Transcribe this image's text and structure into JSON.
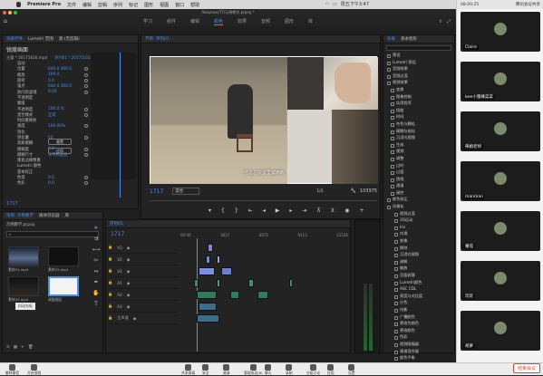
{
  "menubar": {
    "app": "Premiere Pro",
    "items": [
      "文件",
      "编辑",
      "剪辑",
      "序列",
      "标记",
      "图形",
      "视图",
      "窗口",
      "帮助"
    ],
    "clock_left": "周五下午3:47",
    "clock_right": "08:00:25",
    "meeting_label": "腾讯会议共享"
  },
  "window": {
    "title": "/Volumes/T7/示例教学.prproj *"
  },
  "workspaces": {
    "items": [
      "学习",
      "组件",
      "编辑",
      "颜色",
      "效果",
      "音频",
      "图形",
      "库"
    ],
    "active_index": 3
  },
  "effect_controls": {
    "tabs": [
      "效果控件",
      "Lumetri 范围",
      "源:(无剪辑)",
      "音频剪辑混合器:序列01"
    ],
    "title": "锐度画面",
    "source_label": "主要 * 20171616.mp4",
    "clip_label": "序列01 * 20171616.mp4",
    "rows": [
      {
        "k": "运动",
        "v": ""
      },
      {
        "k": "位置",
        "v": "640.0 360.0"
      },
      {
        "k": "缩放",
        "v": "100.0"
      },
      {
        "k": "旋转",
        "v": "0.0"
      },
      {
        "k": "锚点",
        "v": "640.0 360.0"
      },
      {
        "k": "防闪烁滤镜",
        "v": "0.00"
      },
      {
        "k": "不透明度",
        "v": ""
      },
      {
        "k": "蒙版",
        "v": ""
      },
      {
        "k": "不透明度",
        "v": "100.0 %"
      },
      {
        "k": "混合模式",
        "v": "正常"
      },
      {
        "k": "时间重映射",
        "v": ""
      },
      {
        "k": "速度",
        "v": "100.00%"
      },
      {
        "k": "锐化",
        "v": ""
      },
      {
        "k": "锐化量",
        "v": "50"
      },
      {
        "k": "高斯模糊",
        "v": ""
      },
      {
        "k": "模糊度",
        "v": "0.0"
      },
      {
        "k": "模糊尺寸",
        "v": "水平和垂直"
      },
      {
        "k": "重复边缘像素",
        "v": ""
      },
      {
        "k": "Lumetri 颜色",
        "v": ""
      },
      {
        "k": "基本校正",
        "v": ""
      },
      {
        "k": "色温",
        "v": "0.0"
      },
      {
        "k": "色彩",
        "v": "0.0"
      }
    ],
    "btn_reset": "重置",
    "btn_apply": "应用",
    "timecode": "1717"
  },
  "program": {
    "header": "节目: 序列01",
    "subtitle": "他总在院子里做雨靴",
    "timecode": "1717",
    "fit": "适合",
    "quality": "1/2",
    "duration": "103975"
  },
  "project": {
    "tabs": [
      "项目: 示例教学",
      "媒体浏览器",
      "库",
      "信息"
    ],
    "file": "示例教学.prproj",
    "items": [
      {
        "label": "素材01.mp4",
        "time": "3:13"
      },
      {
        "label": "素材02.mp4",
        "time": "5:01"
      },
      {
        "label": "素材03.mp4",
        "time": "2:50"
      },
      {
        "label": "调整图层",
        "time": ""
      }
    ],
    "tooltip": "抖动光标"
  },
  "timeline": {
    "header": "序列01",
    "timecode": "1717",
    "ruler": [
      "00:00",
      "3637",
      "6072",
      "9113",
      "12126"
    ],
    "tracks": [
      "V3",
      "V2",
      "V1",
      "A1",
      "A2",
      "A3",
      "主声道"
    ]
  },
  "right_panel": {
    "tabs": [
      "效果",
      "基本图形"
    ],
    "tree": [
      "预设",
      "Lumetri 预设",
      "音频效果",
      "音频过渡",
      "视频效果",
      "变换",
      "图像控制",
      "实用程序",
      "扭曲",
      "时间",
      "杂色与颗粒",
      "模糊与锐化",
      "沉浸式视频",
      "生成",
      "视频",
      "调整",
      "过时",
      "过渡",
      "透视",
      "通道",
      "键控",
      "颜色校正",
      "风格化",
      "视频过渡",
      "3D运动",
      "Iris",
      "内滑",
      "划像",
      "擦除",
      "沉浸式视频",
      "溶解",
      "缩放",
      "页面剥落",
      "Lumetri颜色",
      "ASC CDL",
      "亮度与对比度",
      "分色",
      "均衡",
      "广播颜色",
      "更改为颜色",
      "更改颜色",
      "色彩",
      "视频限幅器",
      "通道混合器",
      "颜色平衡",
      "颜色替换"
    ]
  },
  "dock": {
    "left": [
      {
        "label": "解除静音"
      },
      {
        "label": "开启视频"
      }
    ],
    "center": [
      {
        "label": "共享屏幕"
      },
      {
        "label": "安全"
      },
      {
        "label": "邀请"
      },
      {
        "label": "管理成员(8)"
      },
      {
        "label": "聊天"
      },
      {
        "label": "录制"
      },
      {
        "label": "分组讨论"
      },
      {
        "label": "应用"
      },
      {
        "label": "设置"
      }
    ],
    "end_meeting": "结束会议"
  },
  "participants": [
    "Claire",
    "bee小蜜蜂菜菜",
    "蒂姆老师",
    "manman",
    "番茄",
    "玩玩",
    "胡萝"
  ],
  "colors": {
    "accent": "#4b8ff0",
    "end_red": "#e04040"
  }
}
